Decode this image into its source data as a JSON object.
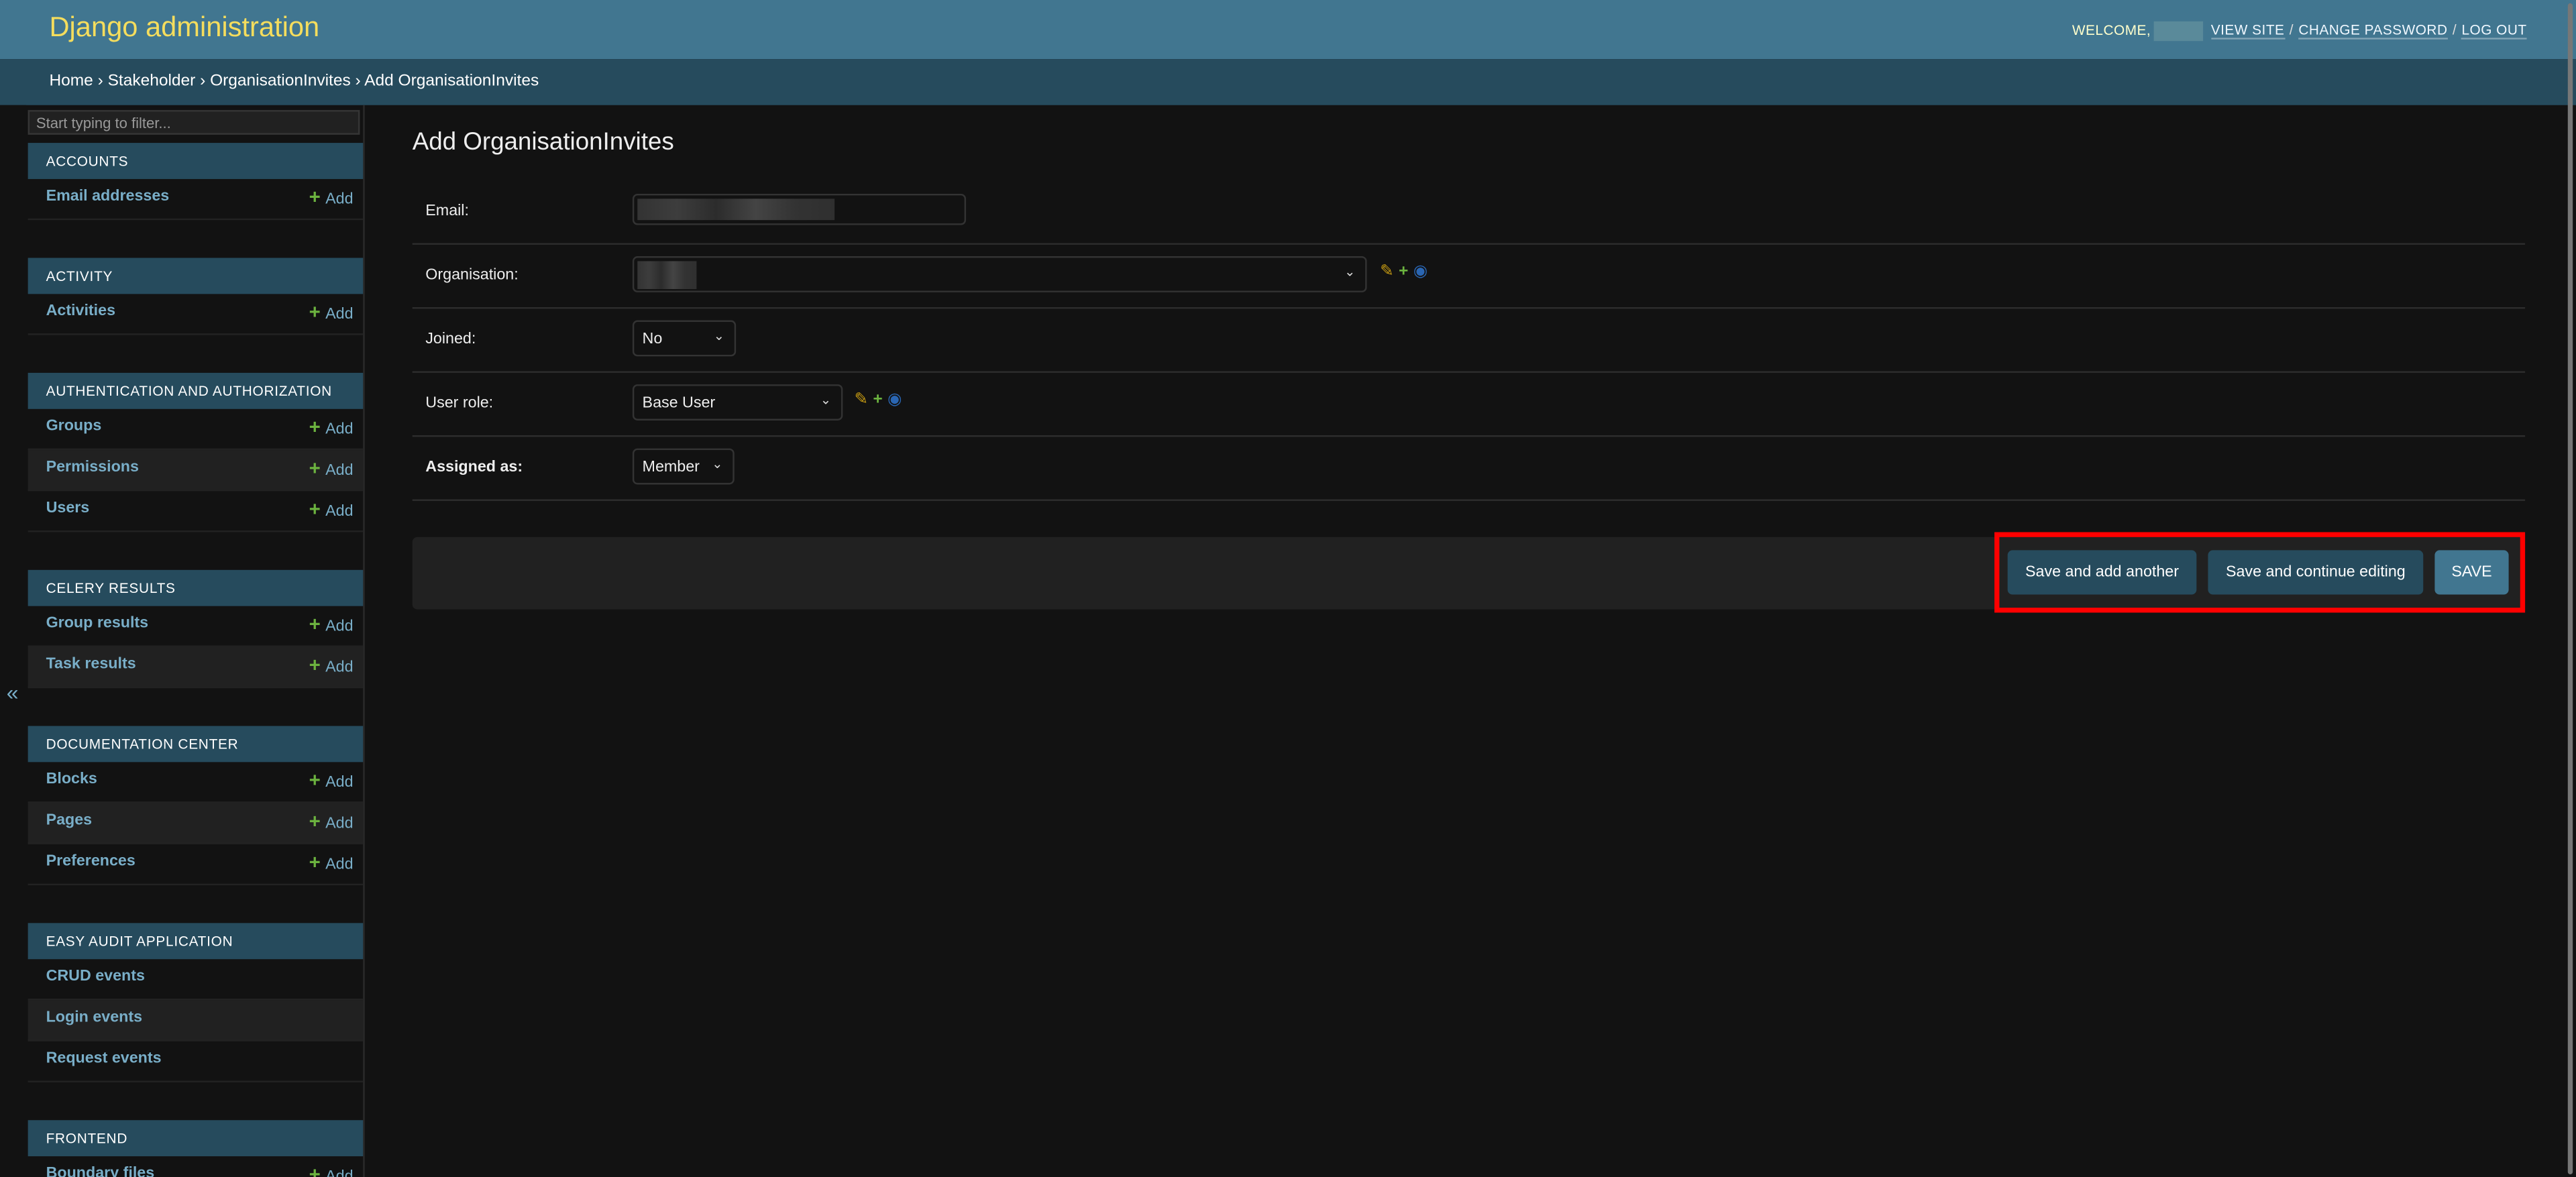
{
  "header": {
    "brand": "Django administration",
    "welcome": "WELCOME,",
    "links": [
      "VIEW SITE",
      "CHANGE PASSWORD",
      "LOG OUT"
    ]
  },
  "breadcrumbs": [
    "Home",
    "Stakeholder",
    "OrganisationInvites",
    "Add OrganisationInvites"
  ],
  "sidebar": {
    "toggle": "«",
    "filter_placeholder": "Start typing to filter...",
    "add_label": "Add",
    "modules": [
      {
        "title": "ACCOUNTS",
        "items": [
          {
            "label": "Email addresses",
            "add": true
          }
        ]
      },
      {
        "title": "ACTIVITY",
        "items": [
          {
            "label": "Activities",
            "add": true
          }
        ]
      },
      {
        "title": "AUTHENTICATION AND AUTHORIZATION",
        "items": [
          {
            "label": "Groups",
            "add": true
          },
          {
            "label": "Permissions",
            "add": true
          },
          {
            "label": "Users",
            "add": true
          }
        ]
      },
      {
        "title": "CELERY RESULTS",
        "items": [
          {
            "label": "Group results",
            "add": true
          },
          {
            "label": "Task results",
            "add": true
          }
        ]
      },
      {
        "title": "DOCUMENTATION CENTER",
        "items": [
          {
            "label": "Blocks",
            "add": true
          },
          {
            "label": "Pages",
            "add": true
          },
          {
            "label": "Preferences",
            "add": true
          }
        ]
      },
      {
        "title": "EASY AUDIT APPLICATION",
        "items": [
          {
            "label": "CRUD events",
            "add": false
          },
          {
            "label": "Login events",
            "add": false
          },
          {
            "label": "Request events",
            "add": false
          }
        ]
      },
      {
        "title": "FRONTEND",
        "items": [
          {
            "label": "Boundary files",
            "add": true
          }
        ]
      }
    ]
  },
  "main": {
    "title": "Add OrganisationInvites",
    "fields": {
      "email": {
        "label": "Email:"
      },
      "organisation": {
        "label": "Organisation:"
      },
      "joined": {
        "label": "Joined:",
        "value": "No"
      },
      "user_role": {
        "label": "User role:",
        "value": "Base User"
      },
      "assigned_as": {
        "label": "Assigned as:",
        "value": "Member"
      }
    },
    "buttons": {
      "save_add": "Save and add another",
      "save_continue": "Save and continue editing",
      "save": "SAVE"
    }
  },
  "icons": {
    "change": "pencil-icon",
    "add": "plus-icon",
    "view": "eye-icon"
  },
  "colors": {
    "header": "#417690",
    "breadcrumbs": "#264b5d",
    "brand": "#f5dd5d",
    "link": "#79aec8",
    "add": "#6cb33f",
    "highlight": "#ff0000"
  }
}
